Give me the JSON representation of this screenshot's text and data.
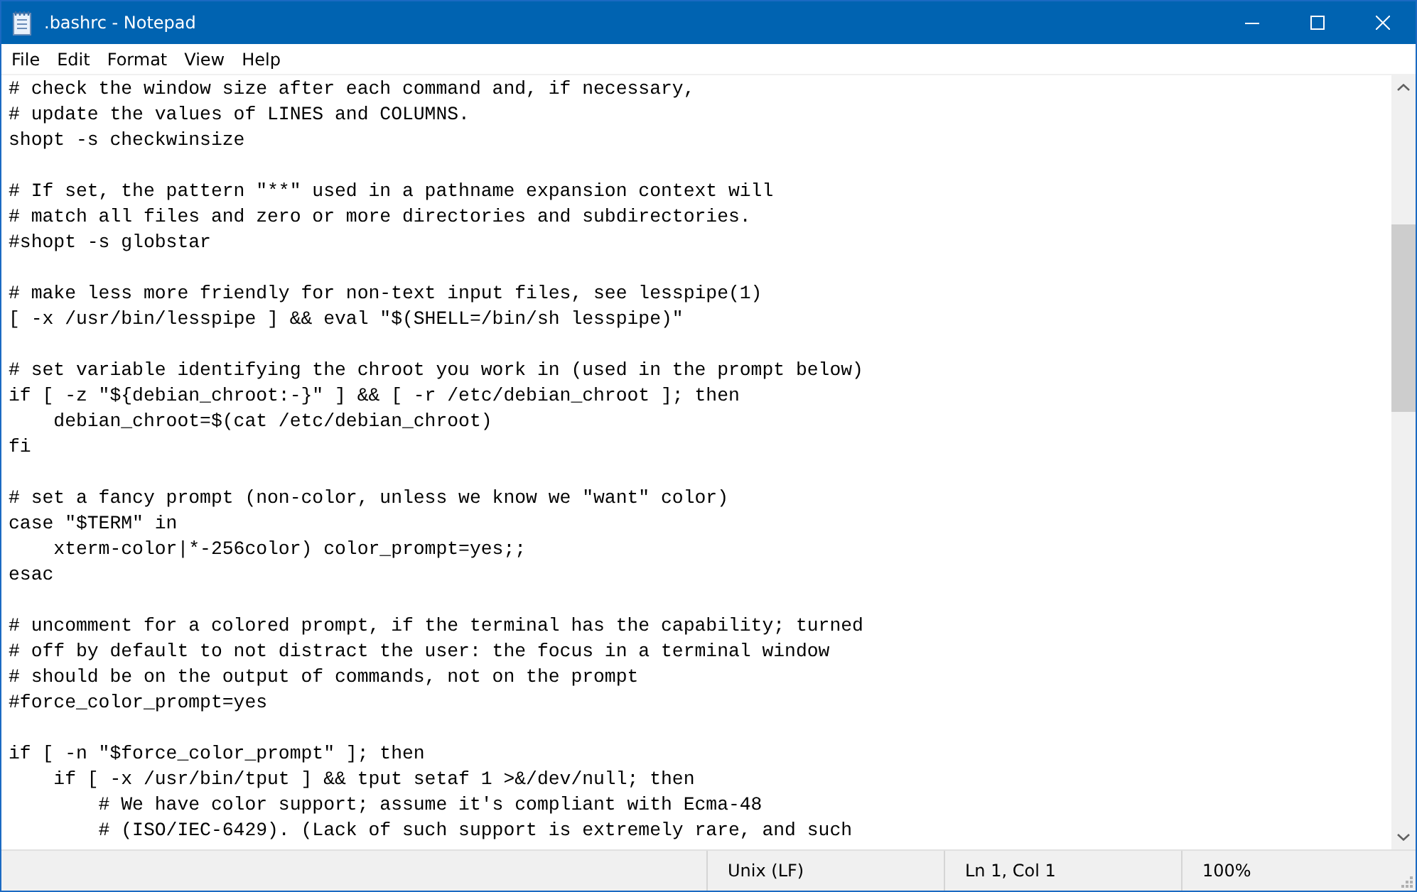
{
  "window": {
    "title": ".bashrc - Notepad"
  },
  "menu": [
    "File",
    "Edit",
    "Format",
    "View",
    "Help"
  ],
  "editor": {
    "blocks": [
      [
        "# check the window size after each command and, if necessary,",
        "# update the values of LINES and COLUMNS.",
        "shopt -s checkwinsize"
      ],
      [
        "# If set, the pattern \"**\" used in a pathname expansion context will",
        "# match all files and zero or more directories and subdirectories.",
        "#shopt -s globstar"
      ],
      [
        "# make less more friendly for non-text input files, see lesspipe(1)",
        "[ -x /usr/bin/lesspipe ] && eval \"$(SHELL=/bin/sh lesspipe)\""
      ],
      [
        "# set variable identifying the chroot you work in (used in the prompt below)",
        "if [ -z \"${debian_chroot:-}\" ] && [ -r /etc/debian_chroot ]; then",
        "    debian_chroot=$(cat /etc/debian_chroot)",
        "fi"
      ],
      [
        "# set a fancy prompt (non-color, unless we know we \"want\" color)",
        "case \"$TERM\" in",
        "    xterm-color|*-256color) color_prompt=yes;;",
        "esac"
      ],
      [
        "# uncomment for a colored prompt, if the terminal has the capability; turned",
        "# off by default to not distract the user: the focus in a terminal window",
        "# should be on the output of commands, not on the prompt",
        "#force_color_prompt=yes"
      ],
      [
        "if [ -n \"$force_color_prompt\" ]; then",
        "    if [ -x /usr/bin/tput ] && tput setaf 1 >&/dev/null; then",
        "        # We have color support; assume it's compliant with Ecma-48",
        "        # (ISO/IEC-6429). (Lack of such support is extremely rare, and such"
      ]
    ]
  },
  "status_bar": [
    "Unix (LF)",
    "Ln 1, Col 1",
    "100%"
  ]
}
